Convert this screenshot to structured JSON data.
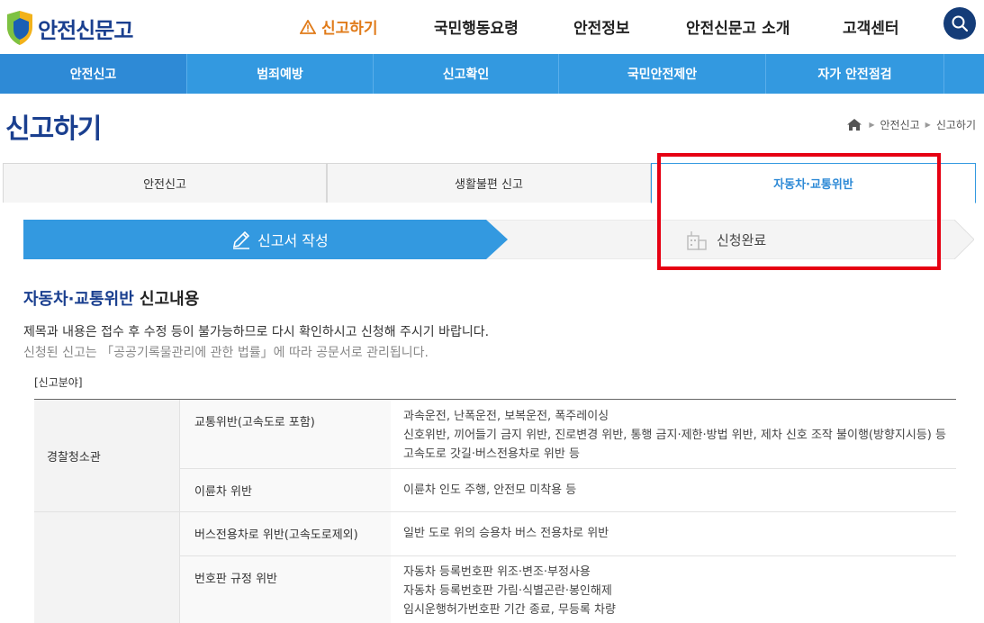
{
  "header": {
    "logo_text": "안전신문고",
    "gnb": [
      "신고하기",
      "국민행동요령",
      "안전정보",
      "안전신문고 소개",
      "고객센터"
    ]
  },
  "subnav": [
    "안전신고",
    "범죄예방",
    "신고확인",
    "국민안전제안",
    "자가 안전점검"
  ],
  "page": {
    "title": "신고하기",
    "breadcrumb": [
      "안전신고",
      "신고하기"
    ]
  },
  "tabs": [
    "안전신고",
    "생활불편 신고",
    "자동차·교통위반"
  ],
  "steps": [
    "신고서 작성",
    "신청완료"
  ],
  "section": {
    "title_accent": "자동차·교통위반",
    "title_rest": " 신고내용",
    "notice1": "제목과 내용은 접수 후 수정 등이 불가능하므로 다시 확인하시고 신청해 주시기 바랍니다.",
    "notice2": "신청된 신고는 「공공기록물관리에 관한 법률」에 따라 공문서로 관리됩니다.",
    "field_label": "[신고분야]"
  },
  "table": {
    "category": "경찰청소관",
    "rows": [
      {
        "sub": "교통위반(고속도로 포함)",
        "desc": [
          "과속운전, 난폭운전, 보복운전, 폭주레이싱",
          "신호위반, 끼어들기 금지 위반, 진로변경 위반, 통행 금지·제한·방법 위반, 제차 신호 조작 불이행(방향지시등) 등",
          "고속도로 갓길·버스전용차로 위반 등"
        ]
      },
      {
        "sub": "이륜차 위반",
        "desc": [
          "이륜차 인도 주행, 안전모 미착용 등"
        ]
      },
      {
        "sub": "버스전용차로 위반(고속도로제외)",
        "desc": [
          "일반 도로 위의 승용차 버스 전용차로 위반"
        ]
      },
      {
        "sub": "번호판 규정 위반",
        "desc": [
          "자동차 등록번호판 위조·변조·부정사용",
          "자동차 등록번호판 가림·식별곤란·봉인해제",
          "임시운행허가번호판 기간 종료, 무등록 차량"
        ]
      }
    ]
  },
  "colors": {
    "brand_navy": "#1a3f8f",
    "nav_blue": "#3399e0",
    "accent_orange": "#e07b1a",
    "highlight_red": "#e60012"
  }
}
